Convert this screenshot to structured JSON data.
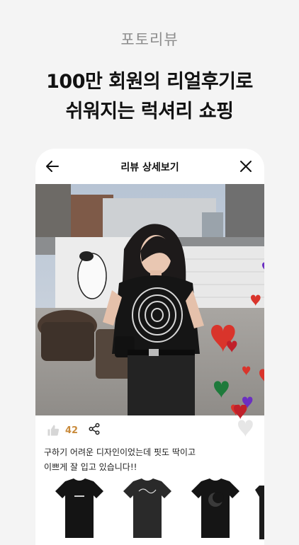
{
  "section_label": "포토리뷰",
  "headline": {
    "line1": "100만 회원의 리얼후기로",
    "line2": "쉬워지는 럭셔리 쇼핑"
  },
  "review": {
    "nav_title": "리뷰 상세보기",
    "like_count": "42",
    "text_line1": "구하기 어려운 디자인이었는데 핏도 딱이고",
    "text_line2": "이쁘게 잘 입고 있습니다!!",
    "photo_alt": "review photo",
    "products": [
      {
        "name": "black-tshirt-small-logo"
      },
      {
        "name": "black-tshirt-signature"
      },
      {
        "name": "black-tshirt-print"
      }
    ]
  },
  "icons": {
    "back": "arrow-left-icon",
    "close": "close-icon",
    "like": "thumbs-up-icon",
    "share": "share-icon",
    "heart": "heart-icon"
  },
  "colors": {
    "accent": "#c98b3c",
    "heart_red": "#d9342b",
    "heart_purple": "#6b2fc2",
    "heart_green": "#1e7a3b",
    "background": "#f4f4f4"
  }
}
